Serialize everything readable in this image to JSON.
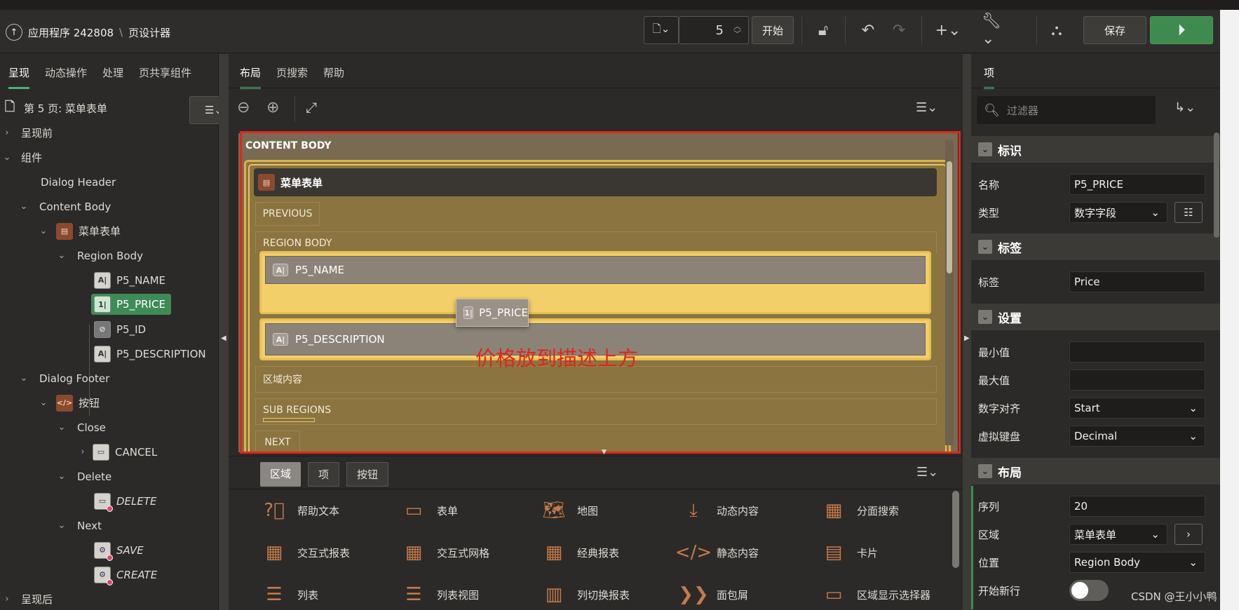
{
  "header": {
    "app_title": "应用程序 242808",
    "separator": "\\",
    "page_designer": "页设计器",
    "page_number": "5",
    "start_label": "开始",
    "save_label": "保存"
  },
  "left_tabs": [
    "呈现",
    "动态操作",
    "处理",
    "页共享组件"
  ],
  "tree": {
    "page_title": "第 5 页: 菜单表单",
    "pre": "呈现前",
    "components": "组件",
    "dialog_header": "Dialog Header",
    "content_body": "Content Body",
    "region": "菜单表单",
    "region_body": "Region Body",
    "items": [
      "P5_NAME",
      "P5_PRICE",
      "P5_ID",
      "P5_DESCRIPTION"
    ],
    "dialog_footer": "Dialog Footer",
    "buttons_region": "按钮",
    "close": "Close",
    "cancel": "CANCEL",
    "delete_group": "Delete",
    "delete": "DELETE",
    "next_group": "Next",
    "save": "SAVE",
    "create": "CREATE",
    "post": "呈现后"
  },
  "center_tabs": [
    "布局",
    "页搜索",
    "帮助"
  ],
  "canvas": {
    "content_body": "CONTENT BODY",
    "region_title": "菜单表单",
    "previous": "PREVIOUS",
    "region_body": "REGION BODY",
    "item_name": "P5_NAME",
    "item_price": "P5_PRICE",
    "item_desc": "P5_DESCRIPTION",
    "region_content": "区域内容",
    "sub_regions": "SUB REGIONS",
    "next": "NEXT",
    "annotation": "价格放到描述上方",
    "annotation_color": "#e0251e"
  },
  "gallery_tabs": [
    "区域",
    "项",
    "按钮"
  ],
  "gallery": [
    [
      "帮助文本",
      "表单",
      "地图",
      "动态内容",
      "分面搜索"
    ],
    [
      "交互式报表",
      "交互式网格",
      "经典报表",
      "静态内容",
      "卡片"
    ],
    [
      "列表",
      "列表视图",
      "列切换报表",
      "面包屑",
      "区域显示选择器"
    ]
  ],
  "right": {
    "tab": "项",
    "filter_placeholder": "过滤器",
    "sec_identity": "标识",
    "name_label": "名称",
    "name_value": "P5_PRICE",
    "type_label": "类型",
    "type_value": "数字字段",
    "sec_label": "标签",
    "label_label": "标签",
    "label_value": "Price",
    "sec_settings": "设置",
    "min_label": "最小值",
    "max_label": "最大值",
    "align_label": "数字对齐",
    "align_value": "Start",
    "keyboard_label": "虚拟键盘",
    "keyboard_value": "Decimal",
    "sec_layout": "布局",
    "seq_label": "序列",
    "seq_value": "20",
    "region_label": "区域",
    "region_value": "菜单表单",
    "position_label": "位置",
    "position_value": "Region Body",
    "newrow_label": "开始新行"
  },
  "watermark": "CSDN @王小小鸭"
}
